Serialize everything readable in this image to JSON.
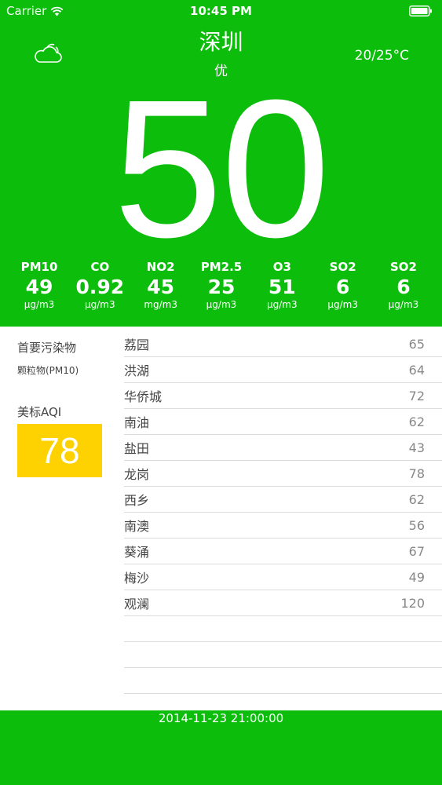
{
  "status_bar": {
    "carrier": "Carrier",
    "time": "10:45 PM"
  },
  "header": {
    "weather_icon": "cloud-icon",
    "city": "深圳",
    "quality": "优",
    "temperature": "20/25°C",
    "aqi": "50"
  },
  "pollutants": [
    {
      "name": "PM10",
      "value": "49",
      "unit": "μg/m3"
    },
    {
      "name": "CO",
      "value": "0.92",
      "unit": "μg/m3"
    },
    {
      "name": "NO2",
      "value": "45",
      "unit": "mg/m3"
    },
    {
      "name": "PM2.5",
      "value": "25",
      "unit": "μg/m3"
    },
    {
      "name": "O3",
      "value": "51",
      "unit": "μg/m3"
    },
    {
      "name": "SO2",
      "value": "6",
      "unit": "μg/m3"
    },
    {
      "name": "SO2",
      "value": "6",
      "unit": "μg/m3"
    }
  ],
  "primary_pollutant": {
    "label": "首要污染物",
    "value": "颗粒物(PM10)"
  },
  "us_aqi": {
    "label": "美标AQI",
    "value": "78",
    "color": "#fdd200"
  },
  "stations": [
    {
      "name": "荔园",
      "value": "65"
    },
    {
      "name": "洪湖",
      "value": "64"
    },
    {
      "name": "华侨城",
      "value": "72"
    },
    {
      "name": "南油",
      "value": "62"
    },
    {
      "name": "盐田",
      "value": "43"
    },
    {
      "name": "龙岗",
      "value": "78"
    },
    {
      "name": "西乡",
      "value": "62"
    },
    {
      "name": "南澳",
      "value": "56"
    },
    {
      "name": "葵涌",
      "value": "67"
    },
    {
      "name": "梅沙",
      "value": "49"
    },
    {
      "name": "观澜",
      "value": "120"
    }
  ],
  "footer": {
    "timestamp": "2014-11-23 21:00:00"
  },
  "colors": {
    "accent_green": "#0cbd0c"
  }
}
